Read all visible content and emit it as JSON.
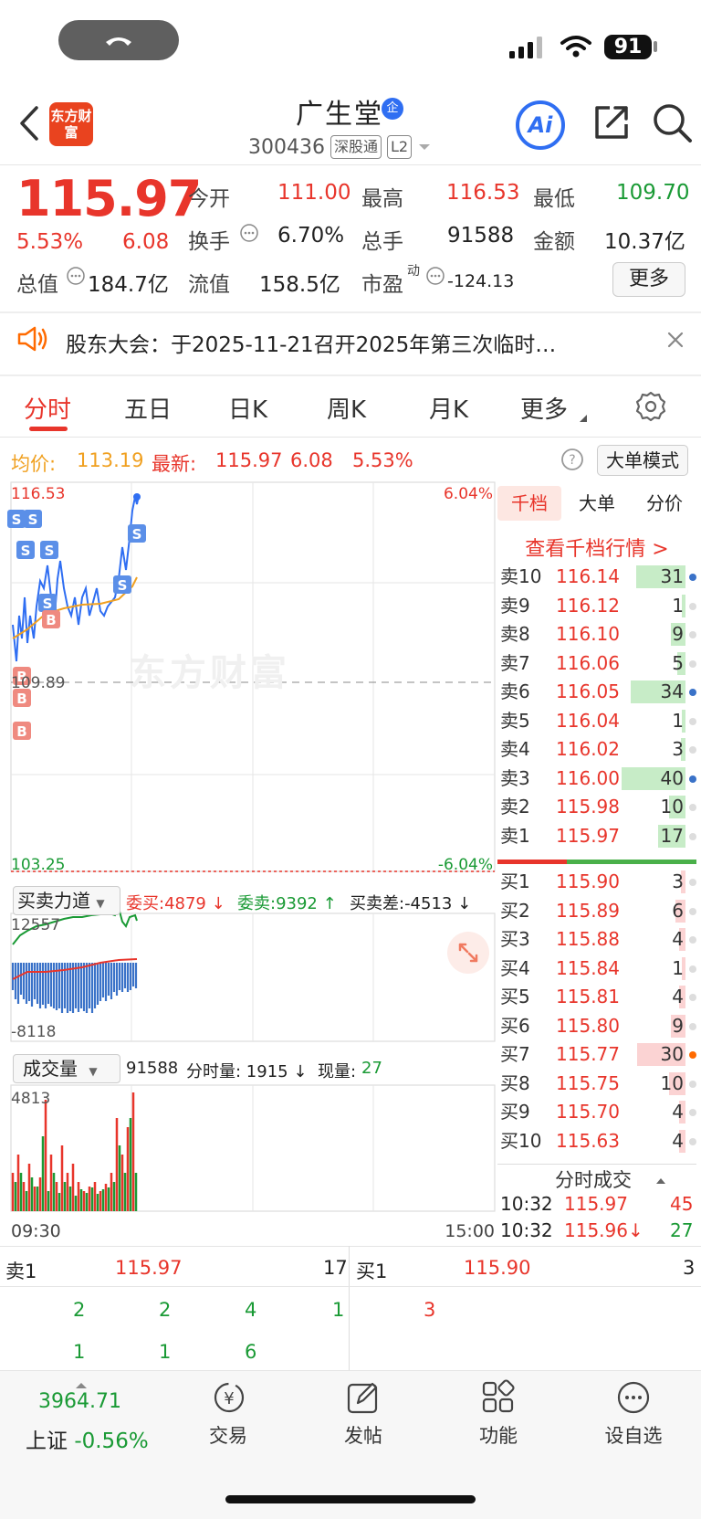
{
  "status": {
    "battery": "91"
  },
  "header": {
    "logo_text": "东方财富",
    "title": "广生堂",
    "badge": "企",
    "code": "300436",
    "tag1": "深股通",
    "tag2": "L2",
    "ai_label": "Ai"
  },
  "quote": {
    "price": "115.97",
    "pct": "5.53%",
    "change": "6.08",
    "open_label": "今开",
    "open": "111.00",
    "high_label": "最高",
    "high": "116.53",
    "low_label": "最低",
    "low": "109.70",
    "turnover_label": "换手",
    "turnover": "6.70%",
    "volume_label": "总手",
    "volume": "91588",
    "amount_label": "金额",
    "amount": "10.37亿",
    "mcap_label": "总值",
    "mcap": "184.7亿",
    "float_label": "流值",
    "float": "158.5亿",
    "pe_label": "市盈",
    "pe_sup": "动",
    "pe": "-124.13",
    "more": "更多"
  },
  "notice": {
    "text": "股东大会：于2025-11-21召开2025年第三次临时…"
  },
  "tabs": [
    "分时",
    "五日",
    "日K",
    "周K",
    "月K",
    "更多"
  ],
  "intraday": {
    "avg_label": "均价:",
    "avg": "113.19",
    "last_label": "最新:",
    "last": "115.97",
    "chg": "6.08",
    "pct": "5.53%",
    "big_order_mode": "大单模式",
    "top_price": "116.53",
    "top_pct": "6.04%",
    "mid_price": "109.89",
    "bottom_price": "103.25",
    "bottom_pct": "-6.04%",
    "watermark": "东方财富",
    "force_title": "买卖力道",
    "force_buy": "委买:4879 ↓",
    "force_sell": "委卖:9392 ↑",
    "force_diff": "买卖差:-4513 ↓",
    "force_top": "12557",
    "force_bottom": "-8118",
    "vol_title": "成交量",
    "vol_total": "91588",
    "vol_min": "分时量: 1915 ↓",
    "vol_now_label": "现量:",
    "vol_now": "27",
    "vol_max": "4813",
    "time_start": "09:30",
    "time_end": "15:00"
  },
  "orderbook": {
    "tabs": [
      "千档",
      "大单",
      "分价"
    ],
    "link": "查看千档行情 >",
    "sells": [
      {
        "label": "卖10",
        "price": "116.14",
        "vol": "31"
      },
      {
        "label": "卖9",
        "price": "116.12",
        "vol": "1"
      },
      {
        "label": "卖8",
        "price": "116.10",
        "vol": "9"
      },
      {
        "label": "卖7",
        "price": "116.06",
        "vol": "5"
      },
      {
        "label": "卖6",
        "price": "116.05",
        "vol": "34"
      },
      {
        "label": "卖5",
        "price": "116.04",
        "vol": "1"
      },
      {
        "label": "卖4",
        "price": "116.02",
        "vol": "3"
      },
      {
        "label": "卖3",
        "price": "116.00",
        "vol": "40"
      },
      {
        "label": "卖2",
        "price": "115.98",
        "vol": "10"
      },
      {
        "label": "卖1",
        "price": "115.97",
        "vol": "17"
      }
    ],
    "buys": [
      {
        "label": "买1",
        "price": "115.90",
        "vol": "3"
      },
      {
        "label": "买2",
        "price": "115.89",
        "vol": "6"
      },
      {
        "label": "买3",
        "price": "115.88",
        "vol": "4"
      },
      {
        "label": "买4",
        "price": "115.84",
        "vol": "1"
      },
      {
        "label": "买5",
        "price": "115.81",
        "vol": "4"
      },
      {
        "label": "买6",
        "price": "115.80",
        "vol": "9"
      },
      {
        "label": "买7",
        "price": "115.77",
        "vol": "30"
      },
      {
        "label": "买8",
        "price": "115.75",
        "vol": "10"
      },
      {
        "label": "买9",
        "price": "115.70",
        "vol": "4"
      },
      {
        "label": "买10",
        "price": "115.63",
        "vol": "4"
      }
    ],
    "ticks_title": "分时成交",
    "ticks": [
      {
        "time": "10:32",
        "price": "115.97",
        "vol": "45"
      },
      {
        "time": "10:32",
        "price": "115.96↓",
        "vol": "27"
      }
    ]
  },
  "level1": {
    "sell_label": "卖1",
    "sell_price": "115.97",
    "sell_vol": "17",
    "buy_label": "买1",
    "buy_price": "115.90",
    "buy_vol": "3",
    "sell_queue_row1": [
      "2",
      "2",
      "4",
      "1"
    ],
    "sell_queue_row2": [
      "1",
      "1",
      "6"
    ],
    "buy_queue_row1": [
      "3"
    ]
  },
  "bottom": {
    "index_value": "3964.71",
    "index_name": "上证",
    "index_pct": "-0.56%",
    "nav": [
      "交易",
      "发帖",
      "功能",
      "设自选"
    ]
  }
}
